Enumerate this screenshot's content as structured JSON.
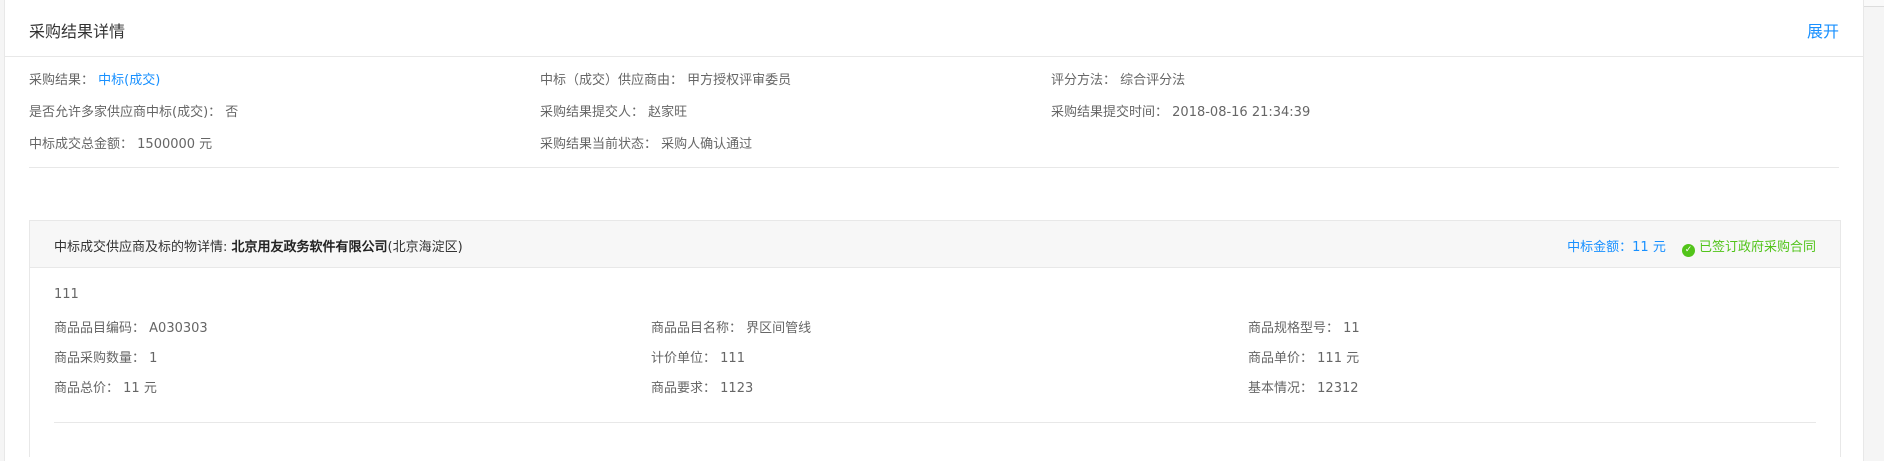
{
  "panel": {
    "title": "采购结果详情",
    "expand_label": "展开"
  },
  "summary": {
    "result_label": "采购结果：",
    "result_value": "中标(成交)",
    "reason_label": "中标（成交）供应商由：",
    "reason_value": "甲方授权评审委员",
    "method_label": "评分方法：",
    "method_value": "综合评分法",
    "multi_label": "是否允许多家供应商中标(成交)：",
    "multi_value": "否",
    "submitter_label": "采购结果提交人：",
    "submitter_value": "赵家旺",
    "submit_time_label": "采购结果提交时间：",
    "submit_time_value": "2018-08-16 21:34:39",
    "total_label": "中标成交总金额：",
    "total_value": "1500000 元",
    "status_label": "采购结果当前状态：",
    "status_value": "采购人确认通过"
  },
  "supplier": {
    "heading_label": "中标成交供应商及标的物详情:",
    "company": "北京用友政务软件有限公司",
    "region": "(北京海淀区)",
    "amount_text": "中标金额：11 元",
    "contract_status": "已签订政府采购合同",
    "item_name": "111",
    "code_label": "商品品目编码：",
    "code_value": "A030303",
    "catname_label": "商品品目名称：",
    "catname_value": "界区间管线",
    "model_label": "商品规格型号：",
    "model_value": "11",
    "qty_label": "商品采购数量：",
    "qty_value": "1",
    "unit_label": "计价单位：",
    "unit_value": "111",
    "price_label": "商品单价：",
    "price_value": "111 元",
    "total_label": "商品总价：",
    "total_value": "11 元",
    "req_label": "商品要求：",
    "req_value": "1123",
    "basic_label": "基本情况：",
    "basic_value": "12312"
  },
  "colors": {
    "accent": "#1890ff",
    "success": "#52c41a",
    "border": "#e8e8e8",
    "header_bg": "#f7f7f7"
  },
  "icons": {
    "signed": "check-circle-icon"
  }
}
